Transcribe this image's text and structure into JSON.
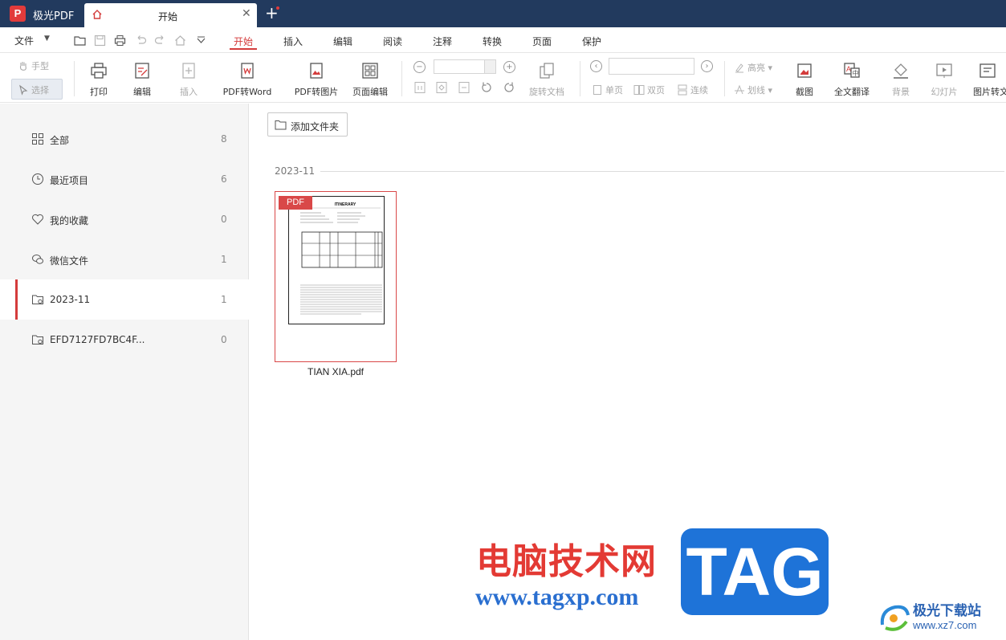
{
  "window": {
    "app_name": "极光PDF",
    "tab_title": "开始"
  },
  "menubar": {
    "file_label": "文件",
    "tabs": [
      "开始",
      "插入",
      "编辑",
      "阅读",
      "注释",
      "转换",
      "页面",
      "保护"
    ],
    "active_tab": "开始"
  },
  "ribbon": {
    "hand_tool": "手型",
    "select_tool": "选择",
    "print": "打印",
    "edit": "编辑",
    "insert": "插入",
    "pdf_to_word": "PDF转Word",
    "pdf_to_image": "PDF转图片",
    "page_edit": "页面编辑",
    "rotate_doc": "旋转文档",
    "single_page": "单页",
    "double_page": "双页",
    "continuous": "连续",
    "highlight": "高亮",
    "strikethrough": "划线",
    "screenshot": "截图",
    "full_translate": "全文翻译",
    "background": "背景",
    "slideshow": "幻灯片",
    "image_to_text": "图片转文"
  },
  "sidebar": {
    "items": [
      {
        "label": "全部",
        "count": "8"
      },
      {
        "label": "最近项目",
        "count": "6"
      },
      {
        "label": "我的收藏",
        "count": "0"
      },
      {
        "label": "微信文件",
        "count": "1"
      },
      {
        "label": "2023-11",
        "count": "1"
      },
      {
        "label": "EFD7127FD7BC4F...",
        "count": "0"
      }
    ],
    "active_index": 4
  },
  "main": {
    "add_folder_label": "添加文件夹",
    "group_label": "2023-11",
    "files": [
      {
        "name": "TIAN XIA.pdf",
        "badge": "PDF",
        "thumb_title": "ITINERARY"
      }
    ]
  },
  "watermark": {
    "cn_text": "电脑技术网",
    "url": "www.tagxp.com",
    "tag": "TAG",
    "brand_cn": "极光下载站",
    "brand_url": "www.xz7.com"
  },
  "colors": {
    "titlebar": "#223a5e",
    "accent_red": "#d43c3c",
    "sidebar_bg": "#f5f5f5",
    "tag_blue": "#1e73d8"
  }
}
